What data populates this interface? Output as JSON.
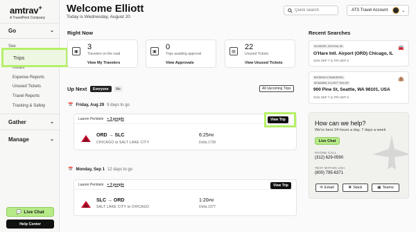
{
  "brand": {
    "name": "amtrav",
    "tagline": "A TravelPerk Company"
  },
  "sidebar": {
    "sections": [
      {
        "label": "Go"
      },
      {
        "label": "See"
      },
      {
        "label": "Gather"
      },
      {
        "label": "Manage"
      }
    ],
    "see_items": [
      "Trips",
      "Invites",
      "Expense Reports",
      "Unused Tickets",
      "Travel Reports",
      "Tracking & Safety"
    ],
    "live_chat": "Live Chat",
    "help_center": "Help Center"
  },
  "header": {
    "welcome": "Welcome Elliott",
    "date": "Today is Wednesday, August 20",
    "search_placeholder": "Quick search",
    "account": "ATS Travel Account"
  },
  "right_now": {
    "title": "Right Now",
    "cards": [
      {
        "icon": "suitcase-icon",
        "number": "3",
        "desc": "Travelers on the road",
        "link": "View My Travelers"
      },
      {
        "icon": "suitcase-icon",
        "number": "0",
        "desc": "Trips awaiting approval",
        "link": "View Approvals"
      },
      {
        "icon": "ticket-icon",
        "number": "22",
        "desc": "Unused Tickets",
        "link": "View Unused Tickets"
      }
    ]
  },
  "up_next": {
    "title": "Up Next",
    "toggle_everyone": "Everyone",
    "toggle_me": "Me",
    "all_trips": "All Upcoming Trips",
    "trips": [
      {
        "day": "Friday, Aug 29",
        "days_to_go": "9 days to go",
        "traveler": "Lauren Perlstein",
        "people": "+ 3 people",
        "view": "View Trip",
        "from": "ORD",
        "to": "SLC",
        "from_city": "CHICAGO",
        "to_city": "SALT LAKE CITY",
        "to_word": "to",
        "time": "6:25",
        "ampm": "PM",
        "flight": "Delta 1739"
      },
      {
        "day": "Monday, Sep 1",
        "days_to_go": "12 days to go",
        "traveler": "Lauren Perlstein",
        "people": "+ 3 people",
        "view": "View Trip",
        "from": "SLC",
        "to": "ORD",
        "from_city": "SALT LAKE CITY",
        "to_city": "CHICAGO",
        "to_word": "to",
        "time": "1:20",
        "ampm": "PM",
        "flight": "Delta 2377"
      }
    ]
  },
  "recent_searches": {
    "title": "Recent Searches",
    "items": [
      {
        "tag": "SCHROPE, CRYSTAL ISI",
        "main": "O'Hare Intl. Airport (ORD) Chicago, IL",
        "sub": "SUN SEP 7  to  FRI SEP 5",
        "icon": "car-icon"
      },
      {
        "tag": "BOOKING # 25481S0SS4",
        "tag2": "MCNAMEE, ELLIOTT TAYLOR",
        "main": "900 Pine St, Seattle, WA 98101, USA",
        "sub": "SUN SEP 7  to  FRI SEP 8",
        "icon": "hotel-icon"
      }
    ]
  },
  "help": {
    "title": "How can we help?",
    "subtitle": "We're here 24 hours a day, 7 days a week",
    "chat": "Live Chat",
    "phone_label": "PHONE CALL",
    "phone": "(312) 629-0590",
    "text_label": "TEXT WITHIN USA",
    "text": "(800) 795-6371",
    "buttons": [
      "Email",
      "Slack",
      "Teams"
    ]
  },
  "colors": {
    "accent": "#b6ea88",
    "highlight": "#b4f067",
    "delta": "#c8102e"
  }
}
